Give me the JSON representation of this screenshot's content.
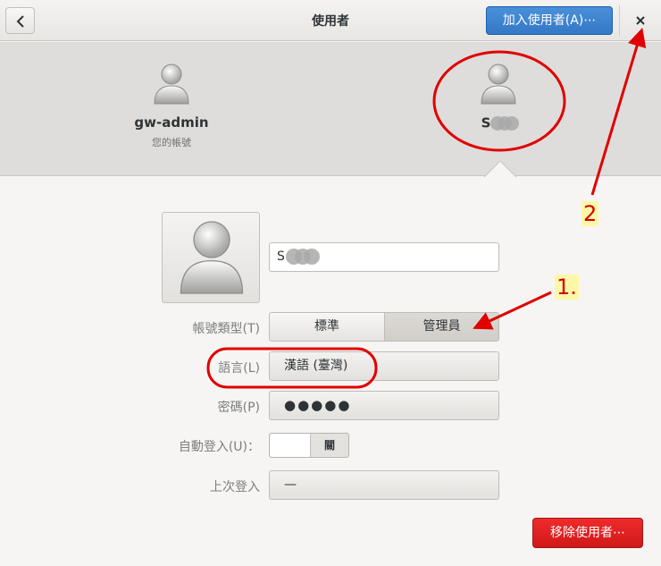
{
  "header": {
    "title": "使用者",
    "add_user_label": "加入使用者(A)⋯"
  },
  "users": [
    {
      "name": "gw-admin",
      "subtitle": "您的帳號"
    },
    {
      "name": "S"
    }
  ],
  "details": {
    "name_value": "S",
    "account_type": {
      "label": "帳號類型(T)",
      "options": [
        "標準",
        "管理員"
      ],
      "selected": "管理員"
    },
    "language": {
      "label": "語言(L)",
      "value": "漢語 (臺灣)"
    },
    "password": {
      "label": "密碼(P)",
      "value": "●●●●●"
    },
    "autologin": {
      "label": "自動登入(U)：",
      "state": "關"
    },
    "last_login": {
      "label": "上次登入",
      "value": "—"
    },
    "remove_label": "移除使用者⋯"
  },
  "annotations": {
    "label_1": "1.",
    "label_2": "2",
    "color": "#e00000"
  },
  "icons": {
    "back": "chevron-left-icon",
    "close": "close-icon",
    "avatar": "user-avatar-icon"
  },
  "colors": {
    "accent": "#3a7fcf",
    "destructive": "#e01b1b",
    "annotation": "#e00000"
  }
}
